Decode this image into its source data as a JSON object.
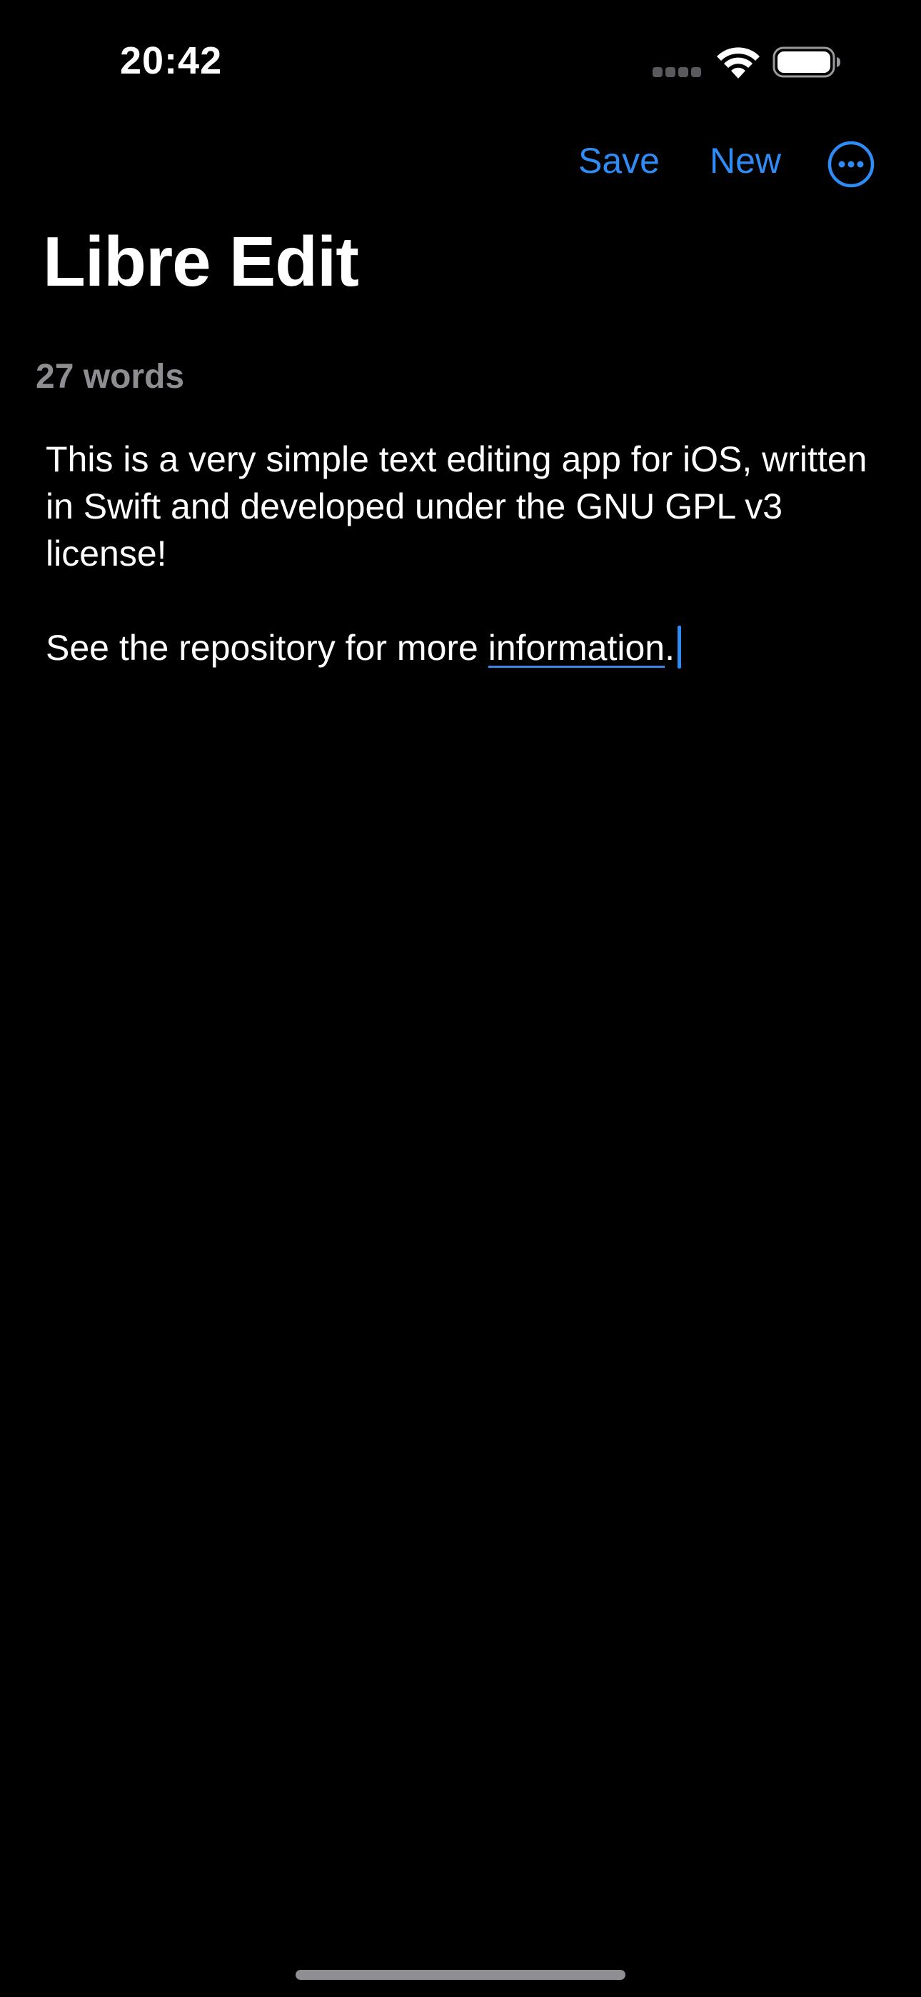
{
  "status_bar": {
    "time": "20:42"
  },
  "nav": {
    "save_label": "Save",
    "new_label": "New",
    "more_icon": "ellipsis-circle-icon"
  },
  "title": "Libre Edit",
  "word_count": "27 words",
  "editor": {
    "paragraph_1": "This is a very simple text editing app for iOS, written in Swift and developed under the GNU GPL v3 license!",
    "paragraph_2_prefix": "See the repository for more ",
    "paragraph_2_link": "information",
    "paragraph_2_suffix": "."
  },
  "colors": {
    "accent": "#2f8cf5",
    "background": "#000000",
    "secondary_text": "#8d8d92"
  }
}
